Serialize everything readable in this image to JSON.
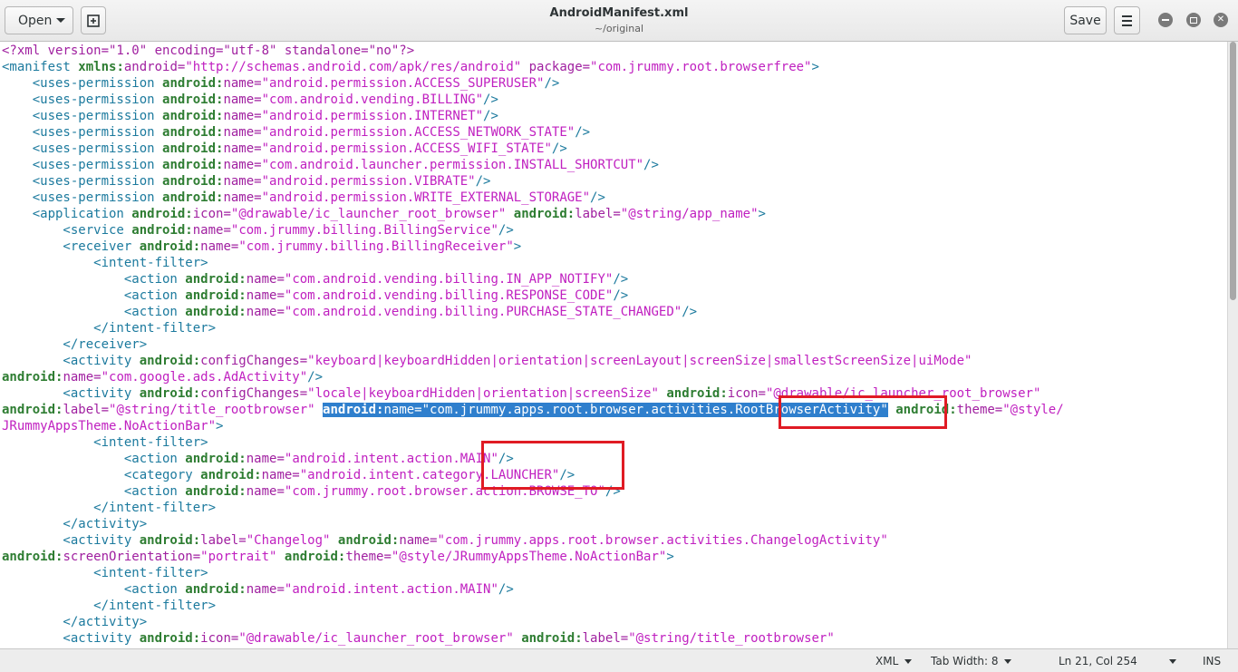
{
  "window": {
    "title": "AndroidManifest.xml",
    "subtitle": "~/original",
    "open_label": "Open",
    "save_label": "Save"
  },
  "editor": {
    "lines": [
      [
        [
          "pi",
          "<?xml version=\"1.0\" encoding=\"utf-8\" standalone=\"no\"?>"
        ]
      ],
      [
        [
          "tag",
          "<manifest "
        ],
        [
          "ns",
          "xmlns:"
        ],
        [
          "attr",
          "android="
        ],
        [
          "val",
          "\"http://schemas.android.com/apk/res/android\""
        ],
        [
          "attr",
          " package="
        ],
        [
          "val",
          "\"com.jrummy.root.browserfree\""
        ],
        [
          "tag",
          ">"
        ]
      ],
      [
        [
          "tag",
          "    <uses-permission "
        ],
        [
          "ns",
          "android:"
        ],
        [
          "attr",
          "name="
        ],
        [
          "val",
          "\"android.permission.ACCESS_SUPERUSER\""
        ],
        [
          "tag",
          "/>"
        ]
      ],
      [
        [
          "tag",
          "    <uses-permission "
        ],
        [
          "ns",
          "android:"
        ],
        [
          "attr",
          "name="
        ],
        [
          "val",
          "\"com.android.vending.BILLING\""
        ],
        [
          "tag",
          "/>"
        ]
      ],
      [
        [
          "tag",
          "    <uses-permission "
        ],
        [
          "ns",
          "android:"
        ],
        [
          "attr",
          "name="
        ],
        [
          "val",
          "\"android.permission.INTERNET\""
        ],
        [
          "tag",
          "/>"
        ]
      ],
      [
        [
          "tag",
          "    <uses-permission "
        ],
        [
          "ns",
          "android:"
        ],
        [
          "attr",
          "name="
        ],
        [
          "val",
          "\"android.permission.ACCESS_NETWORK_STATE\""
        ],
        [
          "tag",
          "/>"
        ]
      ],
      [
        [
          "tag",
          "    <uses-permission "
        ],
        [
          "ns",
          "android:"
        ],
        [
          "attr",
          "name="
        ],
        [
          "val",
          "\"android.permission.ACCESS_WIFI_STATE\""
        ],
        [
          "tag",
          "/>"
        ]
      ],
      [
        [
          "tag",
          "    <uses-permission "
        ],
        [
          "ns",
          "android:"
        ],
        [
          "attr",
          "name="
        ],
        [
          "val",
          "\"com.android.launcher.permission.INSTALL_SHORTCUT\""
        ],
        [
          "tag",
          "/>"
        ]
      ],
      [
        [
          "tag",
          "    <uses-permission "
        ],
        [
          "ns",
          "android:"
        ],
        [
          "attr",
          "name="
        ],
        [
          "val",
          "\"android.permission.VIBRATE\""
        ],
        [
          "tag",
          "/>"
        ]
      ],
      [
        [
          "tag",
          "    <uses-permission "
        ],
        [
          "ns",
          "android:"
        ],
        [
          "attr",
          "name="
        ],
        [
          "val",
          "\"android.permission.WRITE_EXTERNAL_STORAGE\""
        ],
        [
          "tag",
          "/>"
        ]
      ],
      [
        [
          "tag",
          "    <application "
        ],
        [
          "ns",
          "android:"
        ],
        [
          "attr",
          "icon="
        ],
        [
          "val",
          "\"@drawable/ic_launcher_root_browser\""
        ],
        [
          "tag",
          " "
        ],
        [
          "ns",
          "android:"
        ],
        [
          "attr",
          "label="
        ],
        [
          "val",
          "\"@string/app_name\""
        ],
        [
          "tag",
          ">"
        ]
      ],
      [
        [
          "tag",
          "        <service "
        ],
        [
          "ns",
          "android:"
        ],
        [
          "attr",
          "name="
        ],
        [
          "val",
          "\"com.jrummy.billing.BillingService\""
        ],
        [
          "tag",
          "/>"
        ]
      ],
      [
        [
          "tag",
          "        <receiver "
        ],
        [
          "ns",
          "android:"
        ],
        [
          "attr",
          "name="
        ],
        [
          "val",
          "\"com.jrummy.billing.BillingReceiver\""
        ],
        [
          "tag",
          ">"
        ]
      ],
      [
        [
          "tag",
          "            <intent-filter>"
        ]
      ],
      [
        [
          "tag",
          "                <action "
        ],
        [
          "ns",
          "android:"
        ],
        [
          "attr",
          "name="
        ],
        [
          "val",
          "\"com.android.vending.billing.IN_APP_NOTIFY\""
        ],
        [
          "tag",
          "/>"
        ]
      ],
      [
        [
          "tag",
          "                <action "
        ],
        [
          "ns",
          "android:"
        ],
        [
          "attr",
          "name="
        ],
        [
          "val",
          "\"com.android.vending.billing.RESPONSE_CODE\""
        ],
        [
          "tag",
          "/>"
        ]
      ],
      [
        [
          "tag",
          "                <action "
        ],
        [
          "ns",
          "android:"
        ],
        [
          "attr",
          "name="
        ],
        [
          "val",
          "\"com.android.vending.billing.PURCHASE_STATE_CHANGED\""
        ],
        [
          "tag",
          "/>"
        ]
      ],
      [
        [
          "tag",
          "            </intent-filter>"
        ]
      ],
      [
        [
          "tag",
          "        </receiver>"
        ]
      ],
      [
        [
          "tag",
          "        <activity "
        ],
        [
          "ns",
          "android:"
        ],
        [
          "attr",
          "configChanges="
        ],
        [
          "val",
          "\"keyboard|keyboardHidden|orientation|screenLayout|screenSize|smallestScreenSize|uiMode\""
        ]
      ],
      [
        [
          "ns",
          "android:"
        ],
        [
          "attr",
          "name="
        ],
        [
          "val",
          "\"com.google.ads.AdActivity\""
        ],
        [
          "tag",
          "/>"
        ]
      ],
      [
        [
          "tag",
          "        <activity "
        ],
        [
          "ns",
          "android:"
        ],
        [
          "attr",
          "configChanges="
        ],
        [
          "val",
          "\"locale|keyboardHidden|orientation|screenSize\""
        ],
        [
          "tag",
          " "
        ],
        [
          "ns",
          "android:"
        ],
        [
          "attr",
          "icon="
        ],
        [
          "val",
          "\"@drawable/ic_launcher_root_browser\""
        ]
      ],
      [
        [
          "ns",
          "android:"
        ],
        [
          "attr",
          "label="
        ],
        [
          "val",
          "\"@string/title_rootbrowser\""
        ],
        [
          "tag",
          " "
        ],
        [
          "selns",
          "android:"
        ],
        [
          "selattr",
          "name="
        ],
        [
          "selval",
          "\"com.jrummy.apps.root.browser.activities.RootBrowserActivity\""
        ],
        [
          "tag",
          " "
        ],
        [
          "ns",
          "android:"
        ],
        [
          "attr",
          "theme="
        ],
        [
          "val",
          "\"@style/"
        ]
      ],
      [
        [
          "val",
          "JRummyAppsTheme.NoActionBar\""
        ],
        [
          "tag",
          ">"
        ]
      ],
      [
        [
          "tag",
          "            <intent-filter>"
        ]
      ],
      [
        [
          "tag",
          "                <action "
        ],
        [
          "ns",
          "android:"
        ],
        [
          "attr",
          "name="
        ],
        [
          "val",
          "\"android.intent.action.MAIN\""
        ],
        [
          "tag",
          "/>"
        ]
      ],
      [
        [
          "tag",
          "                <category "
        ],
        [
          "ns",
          "android:"
        ],
        [
          "attr",
          "name="
        ],
        [
          "val",
          "\"android.intent.category.LAUNCHER\""
        ],
        [
          "tag",
          "/>"
        ]
      ],
      [
        [
          "tag",
          "                <action "
        ],
        [
          "ns",
          "android:"
        ],
        [
          "attr",
          "name="
        ],
        [
          "val",
          "\"com.jrummy.root.browser.action.BROWSE_TO\""
        ],
        [
          "tag",
          "/>"
        ]
      ],
      [
        [
          "tag",
          "            </intent-filter>"
        ]
      ],
      [
        [
          "tag",
          "        </activity>"
        ]
      ],
      [
        [
          "tag",
          "        <activity "
        ],
        [
          "ns",
          "android:"
        ],
        [
          "attr",
          "label="
        ],
        [
          "val",
          "\"Changelog\""
        ],
        [
          "tag",
          " "
        ],
        [
          "ns",
          "android:"
        ],
        [
          "attr",
          "name="
        ],
        [
          "val",
          "\"com.jrummy.apps.root.browser.activities.ChangelogActivity\""
        ]
      ],
      [
        [
          "ns",
          "android:"
        ],
        [
          "attr",
          "screenOrientation="
        ],
        [
          "val",
          "\"portrait\""
        ],
        [
          "tag",
          " "
        ],
        [
          "ns",
          "android:"
        ],
        [
          "attr",
          "theme="
        ],
        [
          "val",
          "\"@style/JRummyAppsTheme.NoActionBar\""
        ],
        [
          "tag",
          ">"
        ]
      ],
      [
        [
          "tag",
          "            <intent-filter>"
        ]
      ],
      [
        [
          "tag",
          "                <action "
        ],
        [
          "ns",
          "android:"
        ],
        [
          "attr",
          "name="
        ],
        [
          "val",
          "\"android.intent.action.MAIN\""
        ],
        [
          "tag",
          "/>"
        ]
      ],
      [
        [
          "tag",
          "            </intent-filter>"
        ]
      ],
      [
        [
          "tag",
          "        </activity>"
        ]
      ],
      [
        [
          "tag",
          "        <activity "
        ],
        [
          "ns",
          "android:"
        ],
        [
          "attr",
          "icon="
        ],
        [
          "val",
          "\"@drawable/ic_launcher_root_browser\""
        ],
        [
          "tag",
          " "
        ],
        [
          "ns",
          "android:"
        ],
        [
          "attr",
          "label="
        ],
        [
          "val",
          "\"@string/title_rootbrowser\""
        ]
      ]
    ]
  },
  "statusbar": {
    "language": "XML",
    "tab_width": "Tab Width: 8",
    "position": "Ln 21, Col 254",
    "mode": "INS"
  }
}
